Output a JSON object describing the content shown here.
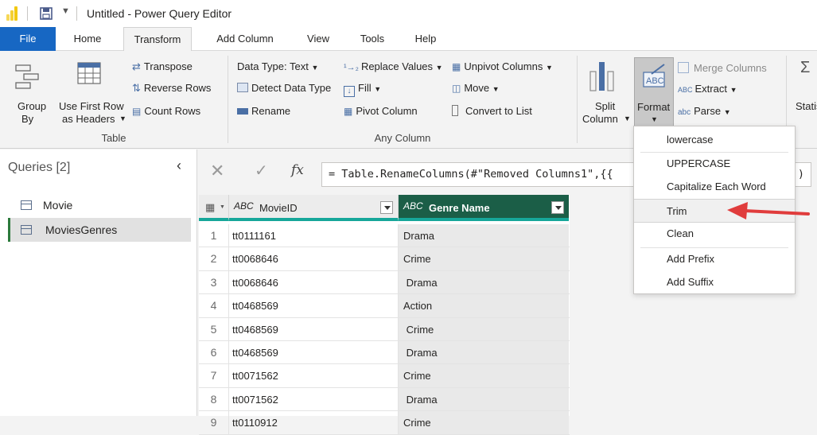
{
  "window": {
    "title": "Untitled - Power Query Editor"
  },
  "tabs": [
    "File",
    "Home",
    "Transform",
    "Add Column",
    "View",
    "Tools",
    "Help"
  ],
  "ribbon": {
    "table_group": {
      "group_by": [
        "Group",
        "By"
      ],
      "use_first_row": [
        "Use First Row",
        "as Headers"
      ],
      "transpose": "Transpose",
      "reverse_rows": "Reverse Rows",
      "count_rows": "Count Rows",
      "label": "Table"
    },
    "any_column_group": {
      "data_type": "Data Type: Text",
      "detect_data_type": "Detect Data Type",
      "rename": "Rename",
      "replace_values": "Replace Values",
      "fill": "Fill",
      "pivot_column": "Pivot Column",
      "unpivot_columns": "Unpivot Columns",
      "move": "Move",
      "convert_to_list": "Convert to List",
      "label": "Any Column"
    },
    "text_group": {
      "split_column": [
        "Split",
        "Column"
      ],
      "format": "Format",
      "merge_columns": "Merge Columns",
      "extract": "Extract",
      "parse": "Parse",
      "statistics_partial": "Statis"
    }
  },
  "queries": {
    "header": "Queries [2]",
    "items": [
      "Movie",
      "MoviesGenres"
    ],
    "selected_index": 1
  },
  "formula_bar": {
    "fx": "fx",
    "formula": "= Table.RenameColumns(#\"Removed Columns1\",{{",
    "formula_tail": ")"
  },
  "grid": {
    "columns": [
      {
        "type_icon": "ABC",
        "name": "MovieID"
      },
      {
        "type_icon": "ABC",
        "name": "Genre Name"
      }
    ],
    "rows": [
      {
        "n": "1",
        "movie_id": "tt0111161",
        "genre": "Drama"
      },
      {
        "n": "2",
        "movie_id": "tt0068646",
        "genre": "Crime"
      },
      {
        "n": "3",
        "movie_id": "tt0068646",
        "genre": " Drama"
      },
      {
        "n": "4",
        "movie_id": "tt0468569",
        "genre": "Action"
      },
      {
        "n": "5",
        "movie_id": "tt0468569",
        "genre": " Crime"
      },
      {
        "n": "6",
        "movie_id": "tt0468569",
        "genre": " Drama"
      },
      {
        "n": "7",
        "movie_id": "tt0071562",
        "genre": "Crime"
      },
      {
        "n": "8",
        "movie_id": "tt0071562",
        "genre": " Drama"
      },
      {
        "n": "9",
        "movie_id": "tt0110912",
        "genre": "Crime"
      }
    ]
  },
  "format_menu": {
    "items": [
      "lowercase",
      "UPPERCASE",
      "Capitalize Each Word",
      "Trim",
      "Clean",
      "Add Prefix",
      "Add Suffix"
    ],
    "highlighted": "Trim"
  },
  "colors": {
    "file_tab": "#1767c3",
    "selected_column_header": "#1b5e47",
    "column_quality_bar": "#16a79a",
    "arrow": "#e03c3c",
    "query_selected_marker": "#2b7a3b"
  }
}
